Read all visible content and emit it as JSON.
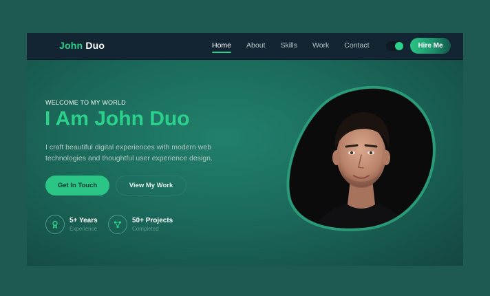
{
  "brand": {
    "first": "John",
    "last": "Duo"
  },
  "nav": {
    "links": [
      "Home",
      "About",
      "Skills",
      "Work",
      "Contact"
    ],
    "active": "Home",
    "hire_label": "Hire Me"
  },
  "hero": {
    "welcome": "WELCOME TO MY WORLD",
    "headline": "I Am John Duo",
    "description": "I craft beautiful digital experiences with modern web technologies and thoughtful user experience design.",
    "primary_cta": "Get In Touch",
    "secondary_cta": "View My Work"
  },
  "stats": [
    {
      "title": "5+ Years",
      "subtitle": "Experience",
      "icon": "award-icon"
    },
    {
      "title": "50+ Projects",
      "subtitle": "Completed",
      "icon": "nodes-icon"
    }
  ],
  "colors": {
    "accent": "#2bd08a",
    "nav_bg": "#132532",
    "page_bg": "#1e5a50"
  }
}
